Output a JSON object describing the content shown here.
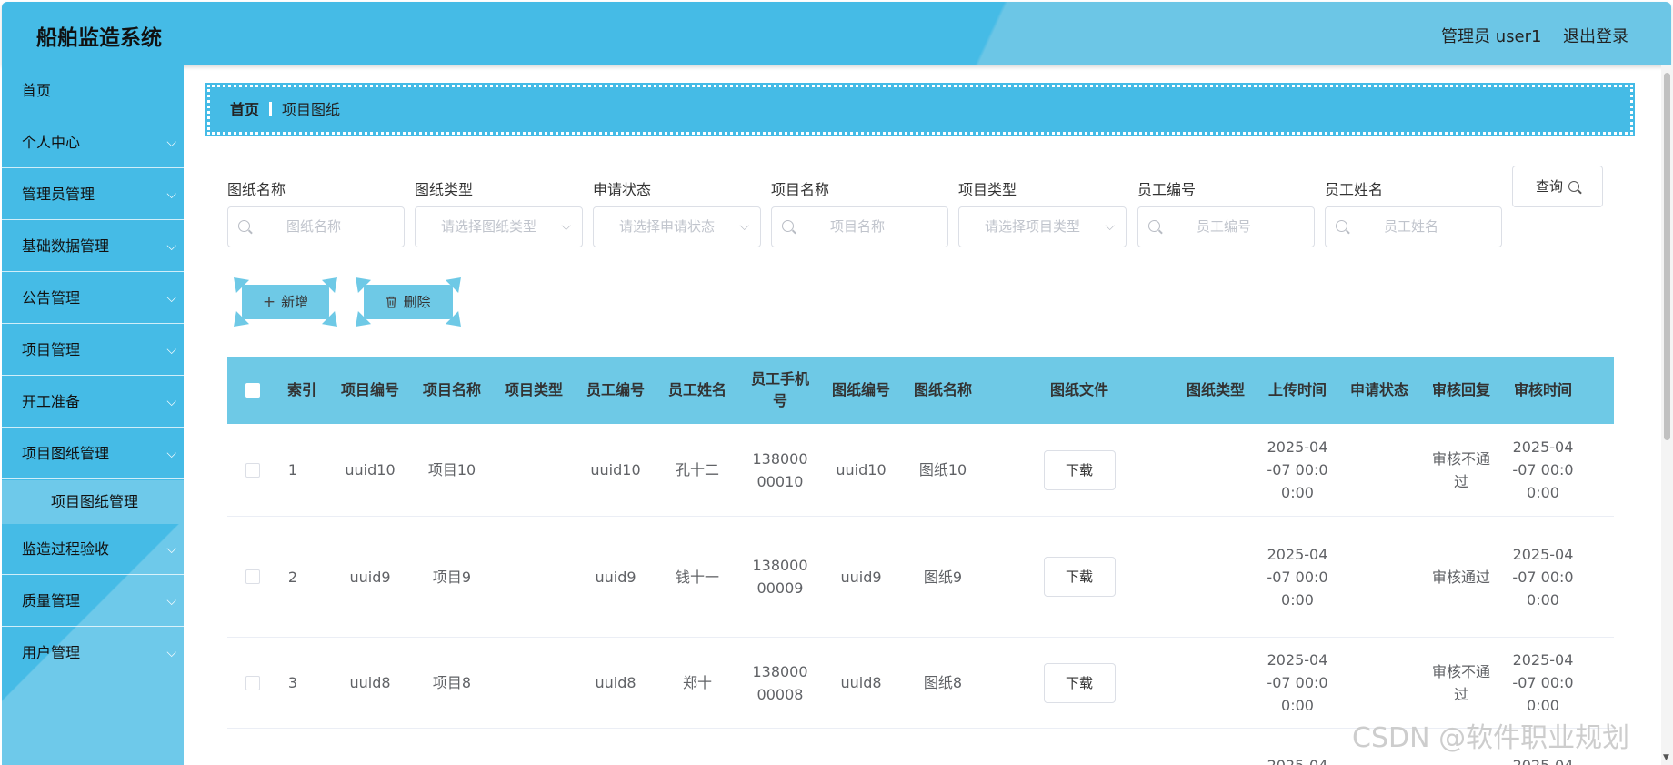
{
  "header": {
    "app_title": "船舶监造系统",
    "user_info": "管理员 user1",
    "logout": "退出登录"
  },
  "sidebar": {
    "items": [
      {
        "label": "首页",
        "has_children": false
      },
      {
        "label": "个人中心",
        "has_children": true
      },
      {
        "label": "管理员管理",
        "has_children": true
      },
      {
        "label": "基础数据管理",
        "has_children": true
      },
      {
        "label": "公告管理",
        "has_children": true
      },
      {
        "label": "项目管理",
        "has_children": true
      },
      {
        "label": "开工准备",
        "has_children": true
      },
      {
        "label": "项目图纸管理",
        "has_children": true,
        "expanded": true
      },
      {
        "label": "监造过程验收",
        "has_children": true
      },
      {
        "label": "质量管理",
        "has_children": true
      },
      {
        "label": "用户管理",
        "has_children": true
      }
    ],
    "active_subitem": "项目图纸管理",
    "chevron_glyph": "⌵"
  },
  "breadcrumb": {
    "home": "首页",
    "current": "项目图纸"
  },
  "filters": {
    "drawing_name": {
      "label": "图纸名称",
      "placeholder": "图纸名称"
    },
    "drawing_type": {
      "label": "图纸类型",
      "placeholder": "请选择图纸类型"
    },
    "apply_status": {
      "label": "申请状态",
      "placeholder": "请选择申请状态"
    },
    "project_name": {
      "label": "项目名称",
      "placeholder": "项目名称"
    },
    "project_type": {
      "label": "项目类型",
      "placeholder": "请选择项目类型"
    },
    "employee_no": {
      "label": "员工编号",
      "placeholder": "员工编号"
    },
    "employee_name": {
      "label": "员工姓名",
      "placeholder": "员工姓名"
    },
    "query_label": "查询"
  },
  "actions": {
    "add_label": "新增",
    "delete_label": "删除"
  },
  "table": {
    "headers": [
      "索引",
      "项目编号",
      "项目名称",
      "项目类型",
      "员工编号",
      "员工姓名",
      "员工手机号",
      "图纸编号",
      "图纸名称",
      "图纸文件",
      "图纸类型",
      "上传时间",
      "申请状态",
      "审核回复",
      "审核时间"
    ],
    "download_label": "下载",
    "rows": [
      {
        "index": "1",
        "project_no": "uuid10",
        "project_name": "项目10",
        "project_type": "",
        "employee_no": "uuid10",
        "employee_name": "孔十二",
        "phone": "13800000010",
        "drawing_no": "uuid10",
        "drawing_name": "图纸10",
        "drawing_type": "",
        "upload_time": "2025-04-07 00:00:00",
        "apply_status": "",
        "review_reply": "审核不通过",
        "review_time": "2025-04-07 00:00:00"
      },
      {
        "index": "2",
        "project_no": "uuid9",
        "project_name": "项目9",
        "project_type": "",
        "employee_no": "uuid9",
        "employee_name": "钱十一",
        "phone": "13800000009",
        "drawing_no": "uuid9",
        "drawing_name": "图纸9",
        "drawing_type": "",
        "upload_time": "2025-04-07 00:00:00",
        "apply_status": "",
        "review_reply": "审核通过",
        "review_time": "2025-04-07 00:00:00"
      },
      {
        "index": "3",
        "project_no": "uuid8",
        "project_name": "项目8",
        "project_type": "",
        "employee_no": "uuid8",
        "employee_name": "郑十",
        "phone": "13800000008",
        "drawing_no": "uuid8",
        "drawing_name": "图纸8",
        "drawing_type": "",
        "upload_time": "2025-04-07 00:00:00",
        "apply_status": "",
        "review_reply": "审核不通过",
        "review_time": "2025-04-07 00:00:00"
      }
    ],
    "partial_row": {
      "upload_time": "2025-04",
      "review_time": "2025-04"
    }
  },
  "watermark": "CSDN @软件职业规划",
  "colors": {
    "primary": "#45bbe6",
    "light": "#6ec9e6",
    "text": "#333333"
  }
}
